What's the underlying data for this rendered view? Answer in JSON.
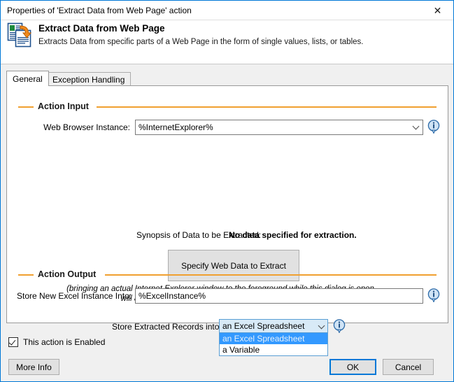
{
  "window": {
    "title": "Properties of 'Extract Data from Web Page' action",
    "close_icon": "close-icon"
  },
  "header": {
    "icon": "extract-data-icon",
    "title": "Extract Data from Web Page",
    "description": "Extracts Data from specific parts of a Web Page in the form of single values, lists, or tables."
  },
  "tabs": [
    {
      "label": "General",
      "active": true
    },
    {
      "label": "Exception Handling",
      "active": false
    }
  ],
  "groups": {
    "action_input": "Action Input",
    "action_output": "Action Output"
  },
  "fields": {
    "web_browser_instance": {
      "label": "Web Browser Instance:",
      "value": "%InternetExplorer%",
      "info_icon": "info-icon"
    },
    "synopsis": {
      "label": "Synopsis of Data to be Extracted:",
      "value": "No data specified for extraction."
    },
    "specify_button": "Specify Web Data to Extract",
    "hint": "(bringing an actual Internet Explorer window to the foreground while this dialog is open will automatically activate the live version of this helper.)",
    "store_records": {
      "label": "Store Extracted Records into",
      "value": "an Excel Spreadsheet",
      "options": [
        "an Excel Spreadsheet",
        "a Variable"
      ],
      "selected_index": 0,
      "info_icon": "info-icon"
    },
    "store_excel_instance": {
      "label": "Store New Excel Instance Into:",
      "value": "%ExcelInstance%",
      "info_icon": "info-icon"
    }
  },
  "footer": {
    "enabled_checkbox_label": "This action is Enabled",
    "enabled_checked": true,
    "more_info": "More Info",
    "ok": "OK",
    "cancel": "Cancel"
  },
  "colors": {
    "accent_border": "#0078d7",
    "group_rule": "#f0a030",
    "highlight": "#3399ff",
    "combo_focus_fill": "#d8eaf7"
  }
}
